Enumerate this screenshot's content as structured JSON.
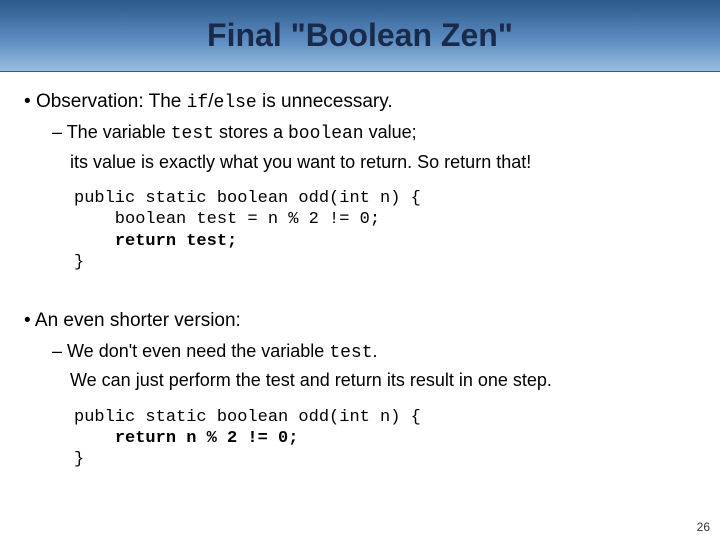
{
  "title": "Final \"Boolean Zen\"",
  "bullets": {
    "obs": {
      "pre": "Observation: The ",
      "code": "if",
      "slash": "/",
      "code2": "else",
      "post": " is unnecessary."
    },
    "obs_sub": {
      "pre": "The variable ",
      "c1": "test",
      "mid1": " stores a ",
      "c2": "boolean",
      "mid2": " value;",
      "line2": "its value is exactly what you want to return.  So return that!"
    },
    "shorter": "An even shorter version:",
    "shorter_sub": {
      "pre": "We don't even need the variable ",
      "c1": "test",
      "post": ".",
      "line2": "We can just perform the test and return its result in one step."
    }
  },
  "code1": {
    "l1": "public static boolean odd(int n) {",
    "l2": "    boolean test = n % 2 != 0;",
    "l3a": "    ",
    "l3b": "return test;",
    "l4": "}"
  },
  "code2": {
    "l1": "public static boolean odd(int n) {",
    "l2a": "    ",
    "l2b": "return n % 2 != 0;",
    "l3": "}"
  },
  "page": "26"
}
